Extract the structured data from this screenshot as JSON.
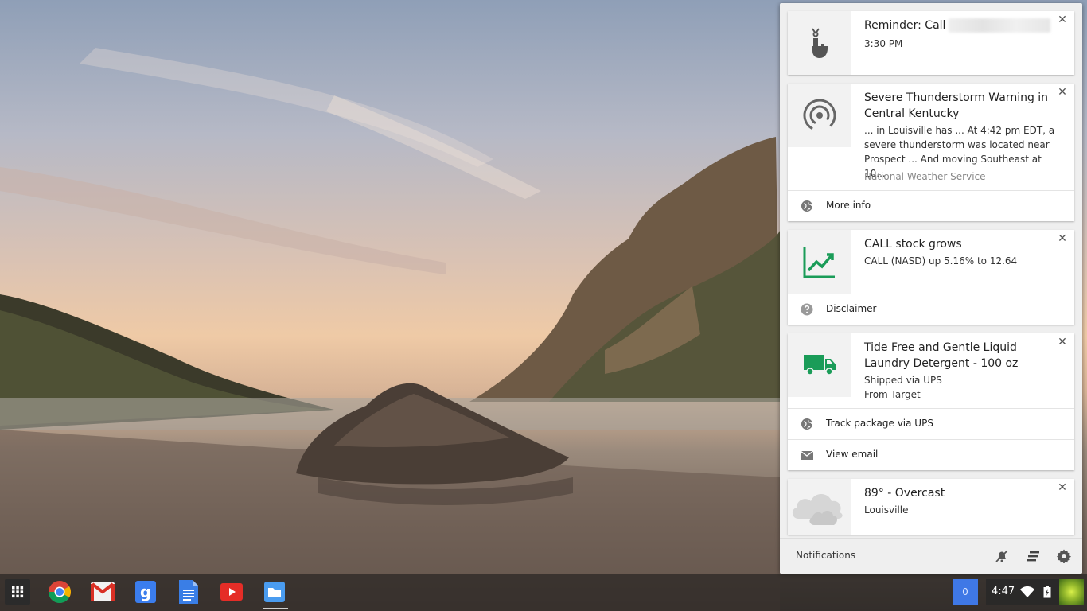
{
  "notifications_panel": {
    "cards": [
      {
        "icon": "ribbon-finger-icon",
        "title": "Reminder: Call",
        "message": "3:30 PM"
      },
      {
        "icon": "broadcast-icon",
        "title": "Severe Thunderstorm Warning in Central Kentucky",
        "message": "... in Louisville has ... At 4:42 pm EDT, a severe thunderstorm was located near Prospect ... And moving Southeast at 10...",
        "source": "National Weather Service",
        "actions": [
          {
            "icon": "globe-icon",
            "label": "More info"
          }
        ]
      },
      {
        "icon": "stock-trend-icon",
        "title": "CALL stock grows",
        "message": "CALL (NASD) up 5.16% to 12.64",
        "actions": [
          {
            "icon": "help-icon",
            "label": "Disclaimer"
          }
        ]
      },
      {
        "icon": "truck-icon",
        "title": "Tide Free and Gentle Liquid Laundry Detergent - 100 oz",
        "message_lines": [
          "Shipped via UPS",
          "From Target"
        ],
        "actions": [
          {
            "icon": "globe-icon",
            "label": "Track package via UPS"
          },
          {
            "icon": "mail-icon",
            "label": "View email"
          }
        ]
      },
      {
        "icon": "cloud-icon",
        "title": "89° - Overcast",
        "message": "Louisville"
      }
    ],
    "footer": {
      "label": "Notifications",
      "buttons": [
        "do-not-disturb-icon",
        "clear-all-icon",
        "settings-icon"
      ]
    }
  },
  "shelf": {
    "apps": [
      "launcher-icon",
      "chrome-icon",
      "gmail-icon",
      "google-search-icon",
      "docs-icon",
      "youtube-icon",
      "files-icon"
    ],
    "notification_count": "0",
    "time": "4:47"
  },
  "colors": {
    "accent_blue": "#3f78e6",
    "stock_green": "#1a9c58",
    "truck_green": "#1a9c58"
  }
}
